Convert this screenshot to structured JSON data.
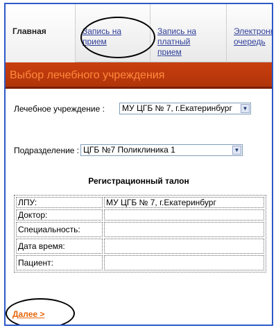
{
  "nav": {
    "items": [
      {
        "label": "Главная"
      },
      {
        "label": "Запись на прием"
      },
      {
        "label": "Запись на платный прием"
      },
      {
        "label": "Электронная очередь"
      }
    ]
  },
  "section_title": "Выбор лечебного учреждения",
  "form": {
    "institution_label": "Лечебное учреждение :",
    "institution_value": "МУ ЦГБ № 7, г.Екатеринбург",
    "department_label": "Подразделение :",
    "department_value": "ЦГБ №7 Поликлиника 1"
  },
  "talon": {
    "title": "Регистрационный талон",
    "rows": [
      {
        "label": "ЛПУ:",
        "value": "МУ ЦГБ № 7, г.Екатеринбург"
      },
      {
        "label": "Доктор:",
        "value": ""
      },
      {
        "label": "Специальность:",
        "value": ""
      },
      {
        "label": "Дата время:",
        "value": ""
      },
      {
        "label": "Пациент:",
        "value": ""
      }
    ]
  },
  "next_label": "Далее >",
  "colors": {
    "frame": "#2b59c8",
    "section_bar": "#b0340a",
    "link": "#e8650a"
  }
}
